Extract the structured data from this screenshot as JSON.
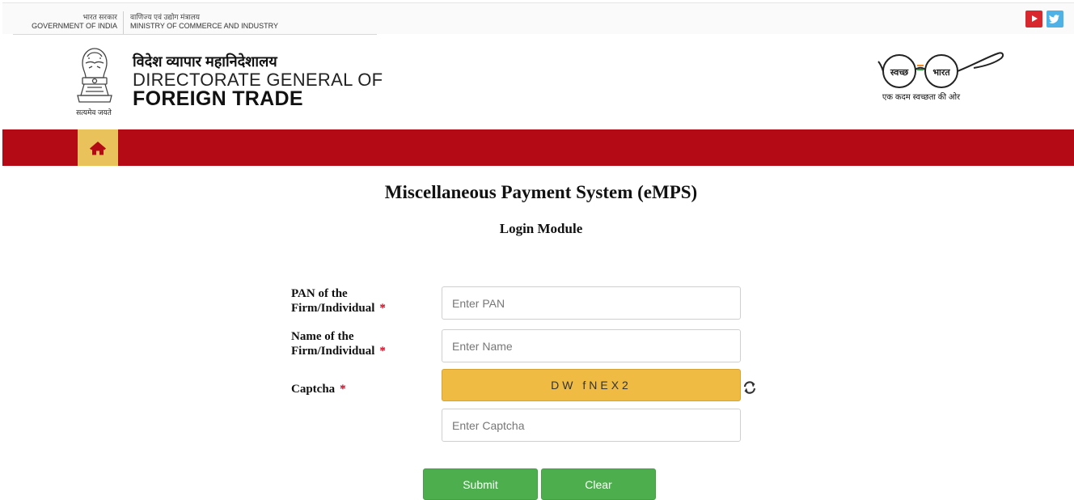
{
  "gov": {
    "left_hi": "भारत सरकार",
    "left_en": "GOVERNMENT OF INDIA",
    "right_hi": "वाणिज्य एवं उद्योग मंत्रालय",
    "right_en": "MINISTRY OF COMMERCE AND INDUSTRY"
  },
  "social": {
    "youtube_icon": "youtube-icon",
    "twitter_icon": "twitter-icon"
  },
  "header": {
    "emblem_caption": "सत्यमेव जयते",
    "org_hi": "विदेश व्यापार महानिदेशालय",
    "org_en_line1": "DIRECTORATE GENERAL OF",
    "org_en_line2": "FOREIGN TRADE",
    "swachh_left": "स्वच्छ",
    "swachh_right": "भारत",
    "swachh_tagline": "एक कदम स्वच्छता की ओर"
  },
  "nav": {
    "home_icon": "home-icon",
    "bar_color": "#b30a16",
    "home_tab_color": "#e9c25b"
  },
  "page": {
    "title": "Miscellaneous Payment System (eMPS)",
    "subtitle": "Login Module"
  },
  "form": {
    "pan_label_1": "PAN of the",
    "pan_label_2": "Firm/Individual",
    "pan_placeholder": "Enter PAN",
    "name_label_1": "Name of the",
    "name_label_2": "Firm/Individual",
    "name_placeholder": "Enter Name",
    "captcha_label": "Captcha",
    "captcha_text": "DW fNEX2",
    "captcha_placeholder": "Enter Captcha",
    "required_mark": "*",
    "submit_label": "Submit",
    "clear_label": "Clear"
  }
}
